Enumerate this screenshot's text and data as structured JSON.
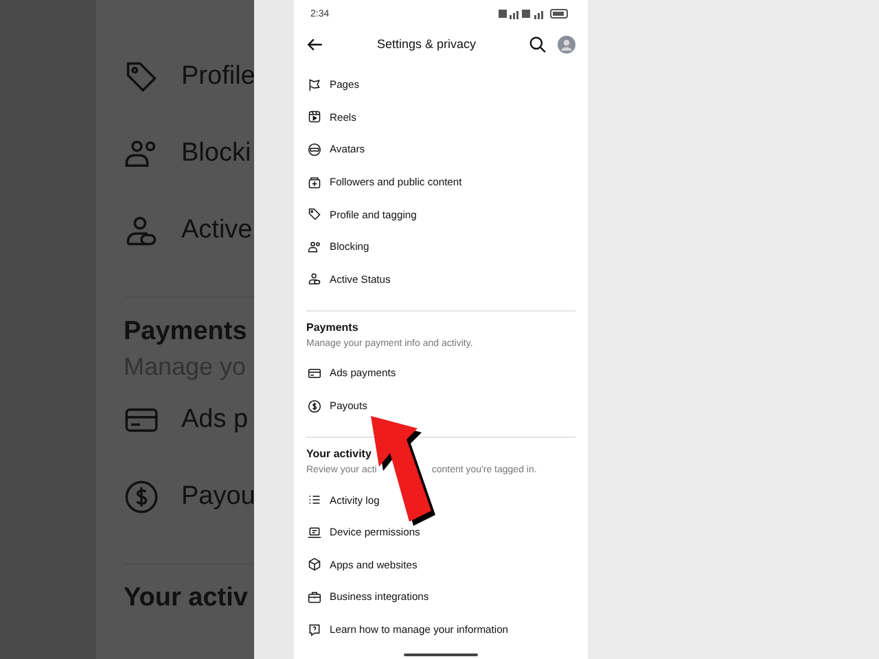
{
  "backdrop": {
    "items": [
      {
        "kind": "item",
        "text": "Profile"
      },
      {
        "kind": "item",
        "text": "Blocki"
      },
      {
        "kind": "item",
        "text": "Active"
      },
      {
        "kind": "divider"
      },
      {
        "kind": "heading",
        "text": "Payments"
      },
      {
        "kind": "subtitle",
        "text": "Manage yo"
      },
      {
        "kind": "item",
        "text": "Ads p"
      },
      {
        "kind": "item",
        "text": "Payou"
      },
      {
        "kind": "divider"
      },
      {
        "kind": "heading",
        "text": "Your activ"
      }
    ]
  },
  "status_bar": {
    "time": "2:34"
  },
  "header": {
    "title": "Settings & privacy"
  },
  "sections": [
    {
      "items": [
        "Pages",
        "Reels",
        "Avatars",
        "Followers and public content",
        "Profile and tagging",
        "Blocking",
        "Active Status"
      ]
    },
    {
      "title": "Payments",
      "description": [
        "Manage your payment info and activity."
      ],
      "items": [
        "Ads payments",
        "Payouts"
      ]
    },
    {
      "title": "Your activity",
      "description": [
        "Review your acti",
        "content you're tagged in."
      ],
      "items": [
        "Activity log",
        "Device permissions",
        "Apps and websites",
        "Business integrations",
        "Learn how to manage your information"
      ]
    }
  ]
}
